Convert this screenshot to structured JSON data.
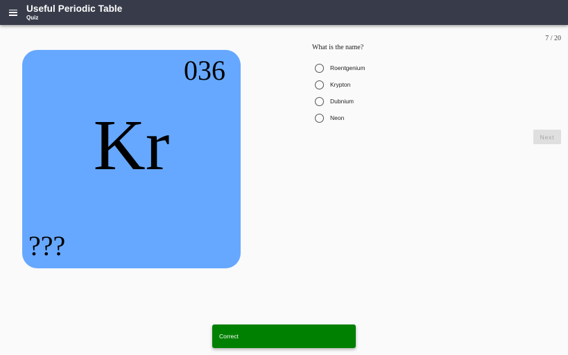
{
  "appbar": {
    "title": "Useful Periodic Table",
    "subtitle": "Quiz",
    "menu_icon": "hamburger-menu-icon",
    "background": "#383c4a"
  },
  "tile": {
    "atomic_number": "036",
    "symbol": "Kr",
    "name": "???",
    "color": "#66a8ff"
  },
  "quiz": {
    "progress": "7 / 20",
    "question": "What is the name?",
    "options": [
      {
        "label": "Roentgenium",
        "selected": false
      },
      {
        "label": "Krypton",
        "selected": false
      },
      {
        "label": "Dubnium",
        "selected": false
      },
      {
        "label": "Neon",
        "selected": false
      }
    ],
    "next_label": "Next",
    "next_enabled": false
  },
  "snackbar": {
    "message": "Correct",
    "color": "#008000"
  }
}
